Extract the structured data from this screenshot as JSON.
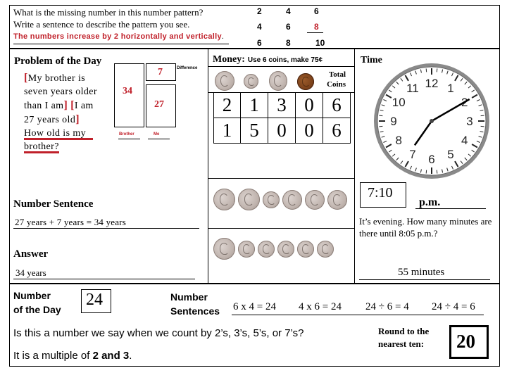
{
  "pattern": {
    "question_line1": "What is the missing number in this number pattern?",
    "question_line2": "Write a sentence to describe the pattern you see.",
    "answer_sentence": "The numbers increase by 2 horizontally and vertically",
    "answer_period": ".",
    "grid": [
      [
        "2",
        "4",
        "6"
      ],
      [
        "4",
        "6",
        "8"
      ],
      [
        "6",
        "8",
        "10"
      ]
    ],
    "missing_value": "8",
    "answer_color": "#c0202a"
  },
  "problem": {
    "title": "Problem of the Day",
    "text_lines": [
      "My brother is",
      "seven years older",
      "than I am",
      "I am",
      "27 years old",
      "How old is my",
      "brother?"
    ],
    "bar_model": {
      "total": "34",
      "difference": "7",
      "me": "27",
      "difference_label": "Difference",
      "brother_label": "Brother",
      "me_label": "Me"
    }
  },
  "money": {
    "title": "Money:",
    "instruction": "Use 6 coins, make 75¢",
    "coin_icons": [
      "quarter-coin-icon",
      "dime-coin-icon",
      "nickel-coin-icon",
      "penny-coin-icon"
    ],
    "total_header": "Total Coins",
    "rows": [
      [
        "2",
        "1",
        "3",
        "0",
        "6"
      ],
      [
        "1",
        "5",
        "0",
        "0",
        "6"
      ]
    ],
    "visual_rows": [
      [
        "quarter",
        "quarter",
        "dime",
        "nickel",
        "nickel",
        "nickel"
      ],
      [
        "quarter",
        "dime",
        "dime",
        "dime",
        "dime",
        "dime"
      ]
    ]
  },
  "time": {
    "title": "Time",
    "clock_hours": [
      "12",
      "1",
      "2",
      "3",
      "4",
      "5",
      "6",
      "7",
      "8",
      "9",
      "10",
      "11"
    ],
    "clock_hour": 7,
    "clock_minute": 10,
    "digital": "7:10",
    "meridiem": "p.m.",
    "question": "It’s evening. How many minutes are there until 8:05 p.m.?",
    "answer": "55 minutes"
  },
  "number_sentence": {
    "title": "Number Sentence",
    "value": "27 years + 7 years = 34 years"
  },
  "answer": {
    "title": "Answer",
    "value": "34 years"
  },
  "number_of_day": {
    "label_line1": "Number",
    "label_line2": "of the Day",
    "value": "24",
    "sentences_label_line1": "Number",
    "sentences_label_line2": "Sentences",
    "sentences": [
      "6 x 4 = 24",
      "4 x 6 = 24",
      "24 ÷ 6 = 4",
      "24 ÷ 4 = 6"
    ],
    "count_question": "Is this a number we say when we count by 2’s, 3’s, 5’s, or 7’s?",
    "multiple_prefix": "It is a multiple of",
    "multiple_value": "2 and 3",
    "multiple_suffix": ".",
    "round_label_line1": "Round to the",
    "round_label_line2": "nearest ten:",
    "round_value": "20"
  }
}
